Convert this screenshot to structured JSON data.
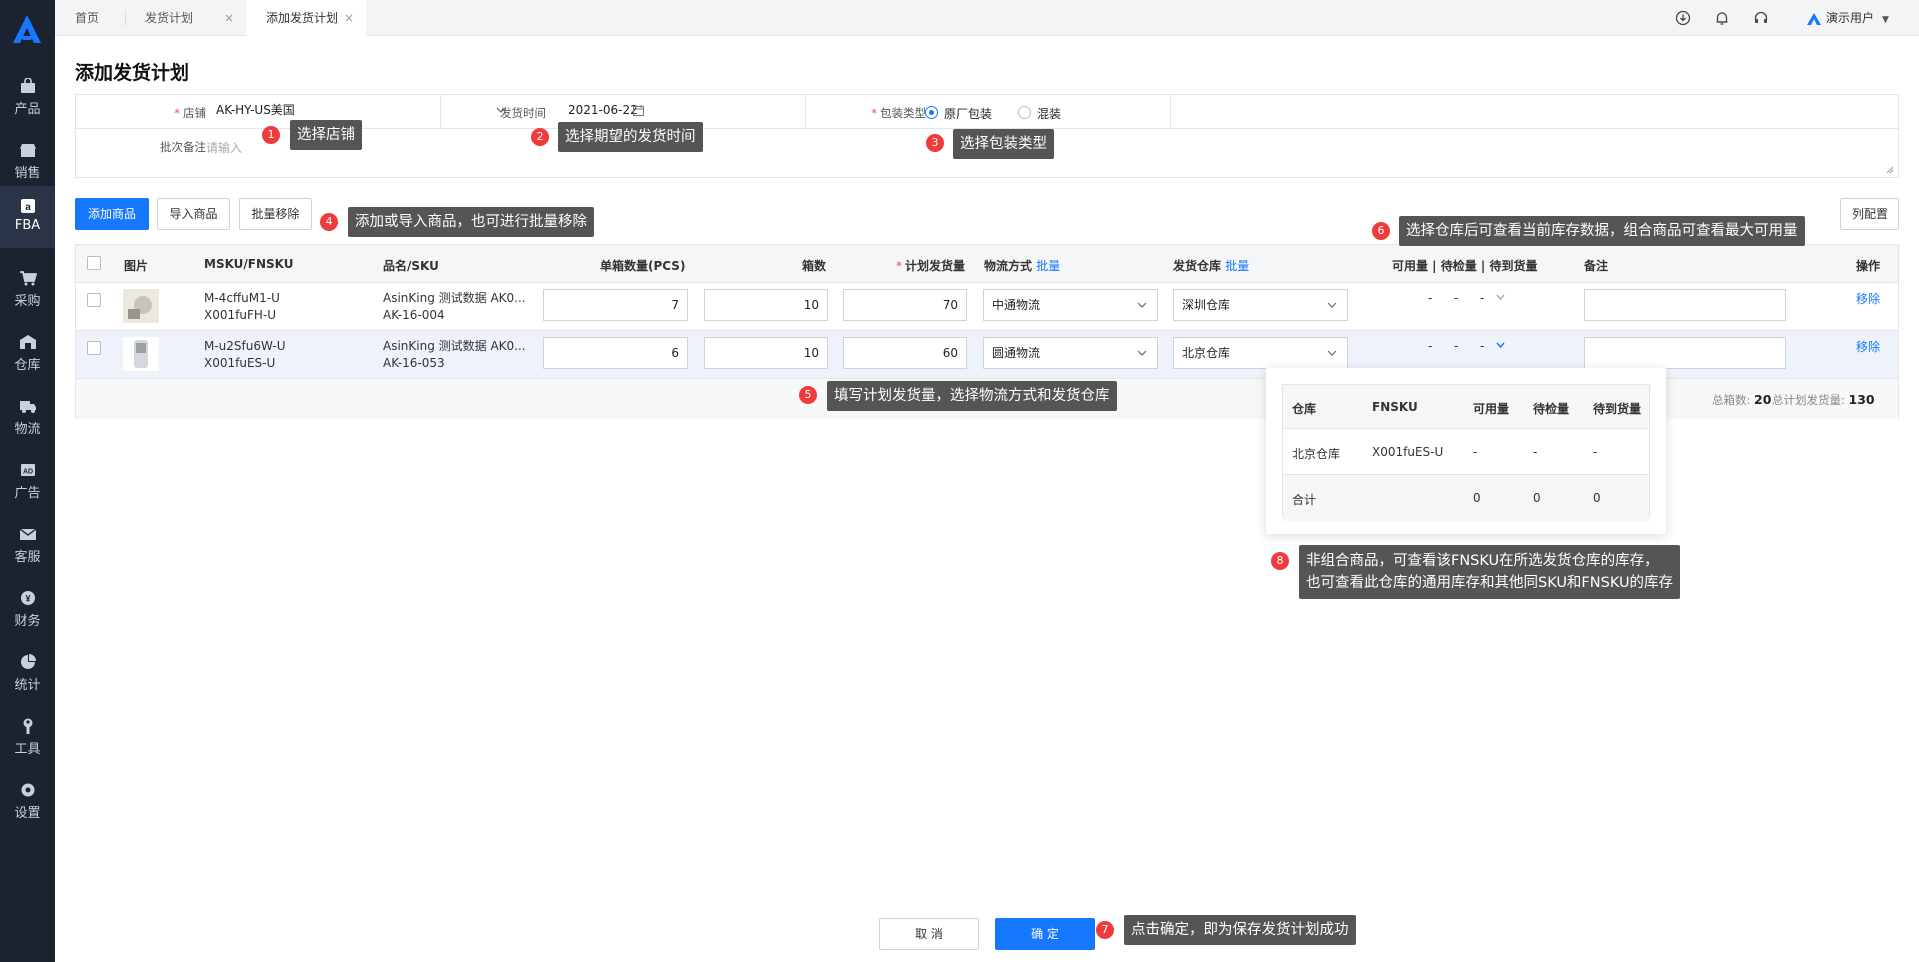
{
  "sidebar": {
    "items": [
      {
        "label": "产品",
        "icon": "bag-icon"
      },
      {
        "label": "销售",
        "icon": "shop-icon"
      },
      {
        "label": "FBA",
        "icon": "amazon-icon"
      },
      {
        "label": "采购",
        "icon": "cart-icon"
      },
      {
        "label": "仓库",
        "icon": "warehouse-icon"
      },
      {
        "label": "物流",
        "icon": "truck-icon"
      },
      {
        "label": "广告",
        "icon": "ad-icon"
      },
      {
        "label": "客服",
        "icon": "mail-icon"
      },
      {
        "label": "财务",
        "icon": "finance-icon"
      },
      {
        "label": "统计",
        "icon": "pie-chart-icon"
      },
      {
        "label": "工具",
        "icon": "wrench-icon"
      },
      {
        "label": "设置",
        "icon": "gear-icon"
      }
    ],
    "active": "FBA",
    "brand_color": "#1677ff"
  },
  "tabs": [
    {
      "label": "首页"
    },
    {
      "label": "发货计划",
      "close": "×"
    },
    {
      "label": "添加发货计划",
      "close": "×"
    }
  ],
  "header": {
    "user": "演示用户"
  },
  "page": {
    "title": "添加发货计划"
  },
  "form": {
    "store_label": "店铺",
    "store_value": "AK-HY-US美国",
    "date_label": "发货时间",
    "date_value": "2021-06-22",
    "pack_label": "包装类型",
    "pack_options": [
      "原厂包装",
      "混装"
    ],
    "note_label": "批次备注",
    "note_placeholder": "请输入"
  },
  "toolbar": {
    "add_label": "添加商品",
    "import_label": "导入商品",
    "batch_remove_label": "批量移除",
    "columns_label": "列配置"
  },
  "table": {
    "headers": {
      "image": "图片",
      "msku": "MSKU/FNSKU",
      "name": "品名/SKU",
      "per_box": "单箱数量(PCS)",
      "boxes": "箱数",
      "planned": "计划发货量",
      "logistics": "物流方式",
      "logistics_batch": "批量",
      "warehouse": "发货仓库",
      "warehouse_batch": "批量",
      "stock": "可用量 | 待检量 | 待到货量",
      "remark": "备注",
      "action": "操作"
    },
    "rows": [
      {
        "msku": "M-4cffuM1-U",
        "fnsku": "X001fuFH-U",
        "name": "AsinKing 测试数据 AK0...",
        "sku": "AK-16-004",
        "per_box": "7",
        "boxes": "10",
        "planned": "70",
        "logistics": "中通物流",
        "warehouse": "深圳仓库",
        "avail": "-",
        "inspect": "-",
        "incoming": "-",
        "action": "移除"
      },
      {
        "msku": "M-u2Sfu6W-U",
        "fnsku": "X001fuES-U",
        "name": "AsinKing 测试数据 AK0...",
        "sku": "AK-16-053",
        "per_box": "6",
        "boxes": "10",
        "planned": "60",
        "logistics": "圆通物流",
        "warehouse": "北京仓库",
        "avail": "-",
        "inspect": "-",
        "incoming": "-",
        "action": "移除"
      }
    ],
    "summary": {
      "boxes_label": "总箱数:",
      "boxes_value": "20",
      "planned_label": "总计划发货量:",
      "planned_value": "130"
    }
  },
  "popover": {
    "headers": [
      "仓库",
      "FNSKU",
      "可用量",
      "待检量",
      "待到货量"
    ],
    "row": [
      "北京仓库",
      "X001fuES-U",
      "-",
      "-",
      "-"
    ],
    "total": [
      "合计",
      "",
      "0",
      "0",
      "0"
    ]
  },
  "annotations": [
    {
      "num": "1",
      "text": "选择店铺"
    },
    {
      "num": "2",
      "text": "选择期望的发货时间"
    },
    {
      "num": "3",
      "text": "选择包装类型"
    },
    {
      "num": "4",
      "text": "添加或导入商品，也可进行批量移除"
    },
    {
      "num": "5",
      "text": "填写计划发货量，选择物流方式和发货仓库"
    },
    {
      "num": "6",
      "text": "选择仓库后可查看当前库存数据，组合商品可查看最大可用量"
    },
    {
      "num": "7",
      "text": "点击确定，即为保存发货计划成功"
    },
    {
      "num": "8",
      "text": "非组合商品，可查看该FNSKU在所选发货仓库的库存，",
      "text2": "也可查看此仓库的通用库存和其他同SKU和FNSKU的库存"
    }
  ],
  "footer": {
    "cancel_label": "取 消",
    "confirm_label": "确 定"
  }
}
